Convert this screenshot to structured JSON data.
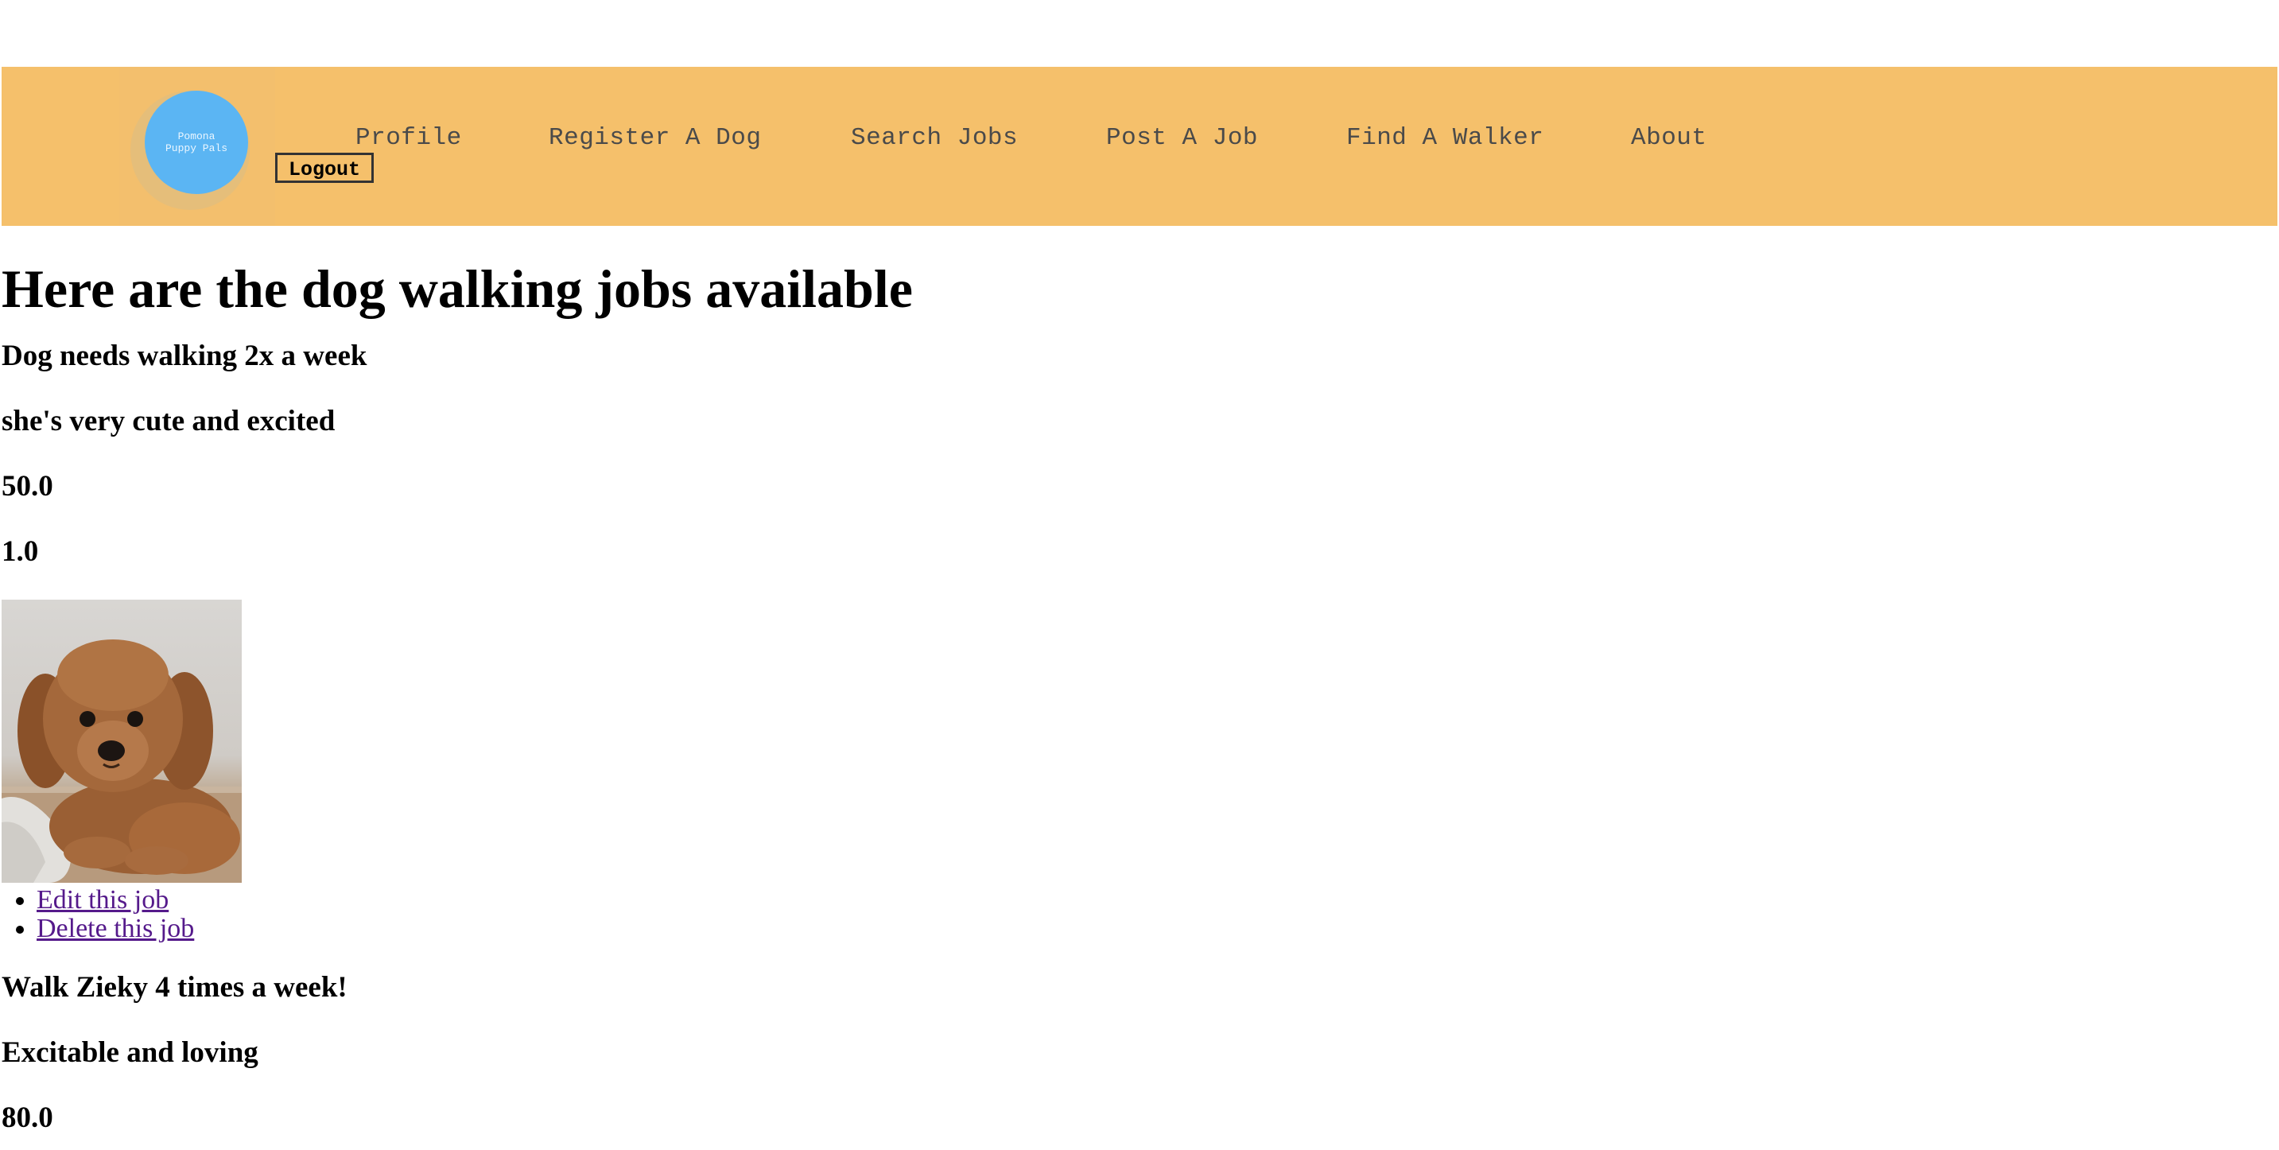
{
  "header": {
    "logo_line1": "Pomona",
    "logo_line2": "Puppy Pals",
    "nav": [
      {
        "label": "Profile"
      },
      {
        "label": "Register A Dog"
      },
      {
        "label": "Search Jobs"
      },
      {
        "label": "Post A Job"
      },
      {
        "label": "Find A Walker"
      },
      {
        "label": "About"
      }
    ],
    "logout_label": "Logout",
    "bar_color": "#f5c06b",
    "logo_color": "#5bb5f3"
  },
  "main": {
    "heading": "Here are the dog walking jobs available",
    "jobs": [
      {
        "title": "Dog needs walking 2x a week",
        "description": "she's very cute and excited",
        "pay": "50.0",
        "hours": "1.0",
        "photo": "puppy-photo",
        "actions": [
          {
            "label": "Edit this job"
          },
          {
            "label": "Delete this job"
          }
        ]
      },
      {
        "title": "Walk Zieky 4 times a week!",
        "description": "Excitable and loving",
        "pay": "80.0"
      }
    ],
    "link_color": "#551a8b"
  }
}
